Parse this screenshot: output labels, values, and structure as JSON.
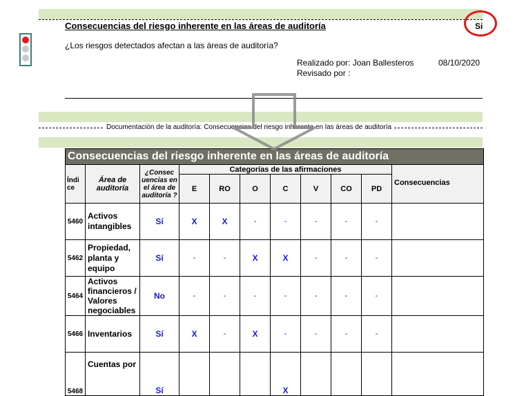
{
  "header": {
    "title": "Consecuencias del riesgo inherente en las áreas de auditoría",
    "answer": "Si",
    "question": "¿Los riesgos detectados afectan a las áreas de auditoría?",
    "performed_label": "Realizado por: Joan Ballesteros",
    "date": "08/10/2020",
    "reviewed_label": "Revisado por :"
  },
  "documentation_label": "Documentación de la auditoría: Consecuencias del riesgo inherente en las áreas de auditoría",
  "table": {
    "title": "Consecuencias del riesgo inherente en las áreas de auditoría",
    "col_index": "Índi ce",
    "col_area": "Área de auditoría",
    "col_consequence_q": "¿Consec uencias en el área de auditoría ?",
    "col_group": "Categorías de las afirmaciones",
    "categories": [
      "E",
      "RO",
      "O",
      "C",
      "V",
      "CO",
      "PD"
    ],
    "col_consequences": "Consecuencias",
    "rows": [
      {
        "index": "5460",
        "area": "Activos intangibles",
        "answer": "Sí",
        "cells": [
          "X",
          "X",
          "-",
          "-",
          "-",
          "-",
          "-"
        ]
      },
      {
        "index": "5462",
        "area": "Propiedad, planta y equipo",
        "answer": "Sí",
        "cells": [
          "-",
          "-",
          "X",
          "X",
          "-",
          "-",
          "-"
        ]
      },
      {
        "index": "5464",
        "area": "Activos financieros / Valores negociables",
        "answer": "No",
        "cells": [
          "-",
          "-",
          "-",
          "-",
          "-",
          "-",
          "-"
        ]
      },
      {
        "index": "5466",
        "area": "Inventarios",
        "answer": "Sí",
        "cells": [
          "X",
          "-",
          "X",
          "-",
          "-",
          "-",
          "-"
        ]
      },
      {
        "index": "5468",
        "area": "Cuentas por",
        "answer": "Sí",
        "cells": [
          "",
          "",
          "",
          "X",
          "",
          "",
          ""
        ]
      }
    ]
  },
  "colors": {
    "band": "#d9e7c3",
    "table_title_bg": "#706f63",
    "mark": "#1a1ad6",
    "highlight_circle": "#e01818"
  }
}
